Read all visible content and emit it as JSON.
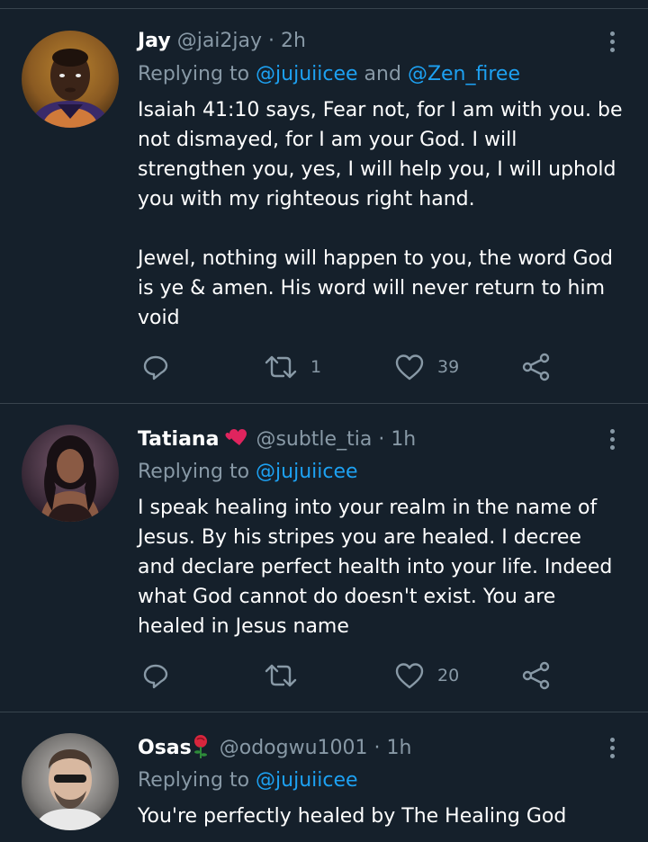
{
  "tweets": [
    {
      "name": "Jay",
      "handle": "@jai2jay",
      "dot": "·",
      "time": "2h",
      "replying_prefix": "Replying to ",
      "mention1": "@jujuiicee",
      "and": " and ",
      "mention2": "@Zen_firee",
      "body": "Isaiah 41:10 says, Fear not, for I am with you. be\nnot dismayed, for I am your God. I will\nstrengthen you, yes, I will help you, I will uphold\nyou with my righteous right hand.\n\nJewel, nothing will happen to you, the word God\nis ye & amen. His word will never return to him\nvoid",
      "retweet_count": "1",
      "like_count": "39"
    },
    {
      "name": "Tatiana",
      "name_emoji": "two-hearts-emoji",
      "handle": "@subtle_tia",
      "dot": "·",
      "time": "1h",
      "replying_prefix": "Replying to ",
      "mention1": "@jujuiicee",
      "body": "I speak healing into your realm in the name of\nJesus. By his stripes you are healed. I decree\nand declare perfect health into your life. Indeed\nwhat God cannot do doesn't exist. You are\nhealed in Jesus name",
      "retweet_count": "",
      "like_count": "20"
    },
    {
      "name": "Osas",
      "name_emoji": "rose-emoji",
      "handle": "@odogwu1001",
      "dot": "·",
      "time": "1h",
      "replying_prefix": "Replying to ",
      "mention1": "@jujuiicee",
      "body": "You're perfectly healed by The Healing God"
    }
  ],
  "colors": {
    "background": "#15202b",
    "divider": "#38444d",
    "secondary_text": "#8899a6",
    "link": "#1da1f2",
    "primary_text": "#ffffff"
  },
  "icons": [
    "reply-icon",
    "retweet-icon",
    "like-icon",
    "share-icon",
    "more-options-icon"
  ]
}
